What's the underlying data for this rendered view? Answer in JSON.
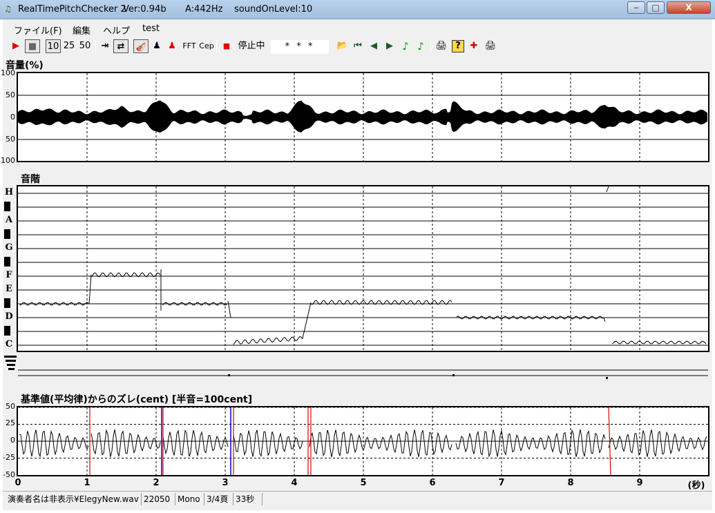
{
  "window": {
    "title_parts": [
      "RealTimePitchChecker 2",
      "Ver:0.94b",
      "A:442Hz",
      "soundOnLevel:10"
    ],
    "min_label": "‒",
    "max_label": "□",
    "close_label": "X"
  },
  "menu": [
    "ファイル(F)",
    "編集",
    "ヘルプ",
    "test"
  ],
  "toolbar": {
    "play_icon": "▶",
    "stop_icon": "■",
    "speeds": [
      "10",
      "25",
      "50"
    ],
    "jump_icon": "⇥",
    "loop_icon": "⇄",
    "violin_icon": "🎻",
    "person_icon": "♟",
    "person_red_icon": "♟",
    "fft_label": "FFT",
    "cep_label": "Cep",
    "record_icon": "■",
    "status_label": "停止中",
    "display_value": "* * *",
    "open_icon": "📂",
    "first_icon": "⏮",
    "prev_icon": "◀",
    "next_icon": "▶",
    "note_icon_1": "♪",
    "note_icon_2": "♪",
    "print_icon": "🖨",
    "help_icon": "?",
    "marker_icon": "✚",
    "print2_icon": "🖨"
  },
  "volume_panel": {
    "label": "音量(%)",
    "y_ticks": [
      "100",
      "50",
      "0",
      "50",
      "100"
    ]
  },
  "scale_panel": {
    "label": "音階",
    "notes": [
      "H",
      "A",
      "G",
      "F",
      "E",
      "D",
      "C"
    ]
  },
  "cent_panel": {
    "label": "基準値(平均律)からのズレ(cent) [半音=100cent]",
    "y_ticks": [
      "50",
      "25",
      "0",
      "-25",
      "-50"
    ]
  },
  "x_axis": {
    "ticks": [
      "0",
      "1",
      "2",
      "3",
      "4",
      "5",
      "6",
      "7",
      "8",
      "9"
    ],
    "unit": "(秒)"
  },
  "status": [
    "演奏者名は非表示¥ElegyNew.wav",
    "22050",
    "Mono",
    "3/4頁",
    "33秒"
  ],
  "colors": {
    "onset_red": "#e00000",
    "onset_blue": "#0000c0",
    "grid": "#000000"
  }
}
